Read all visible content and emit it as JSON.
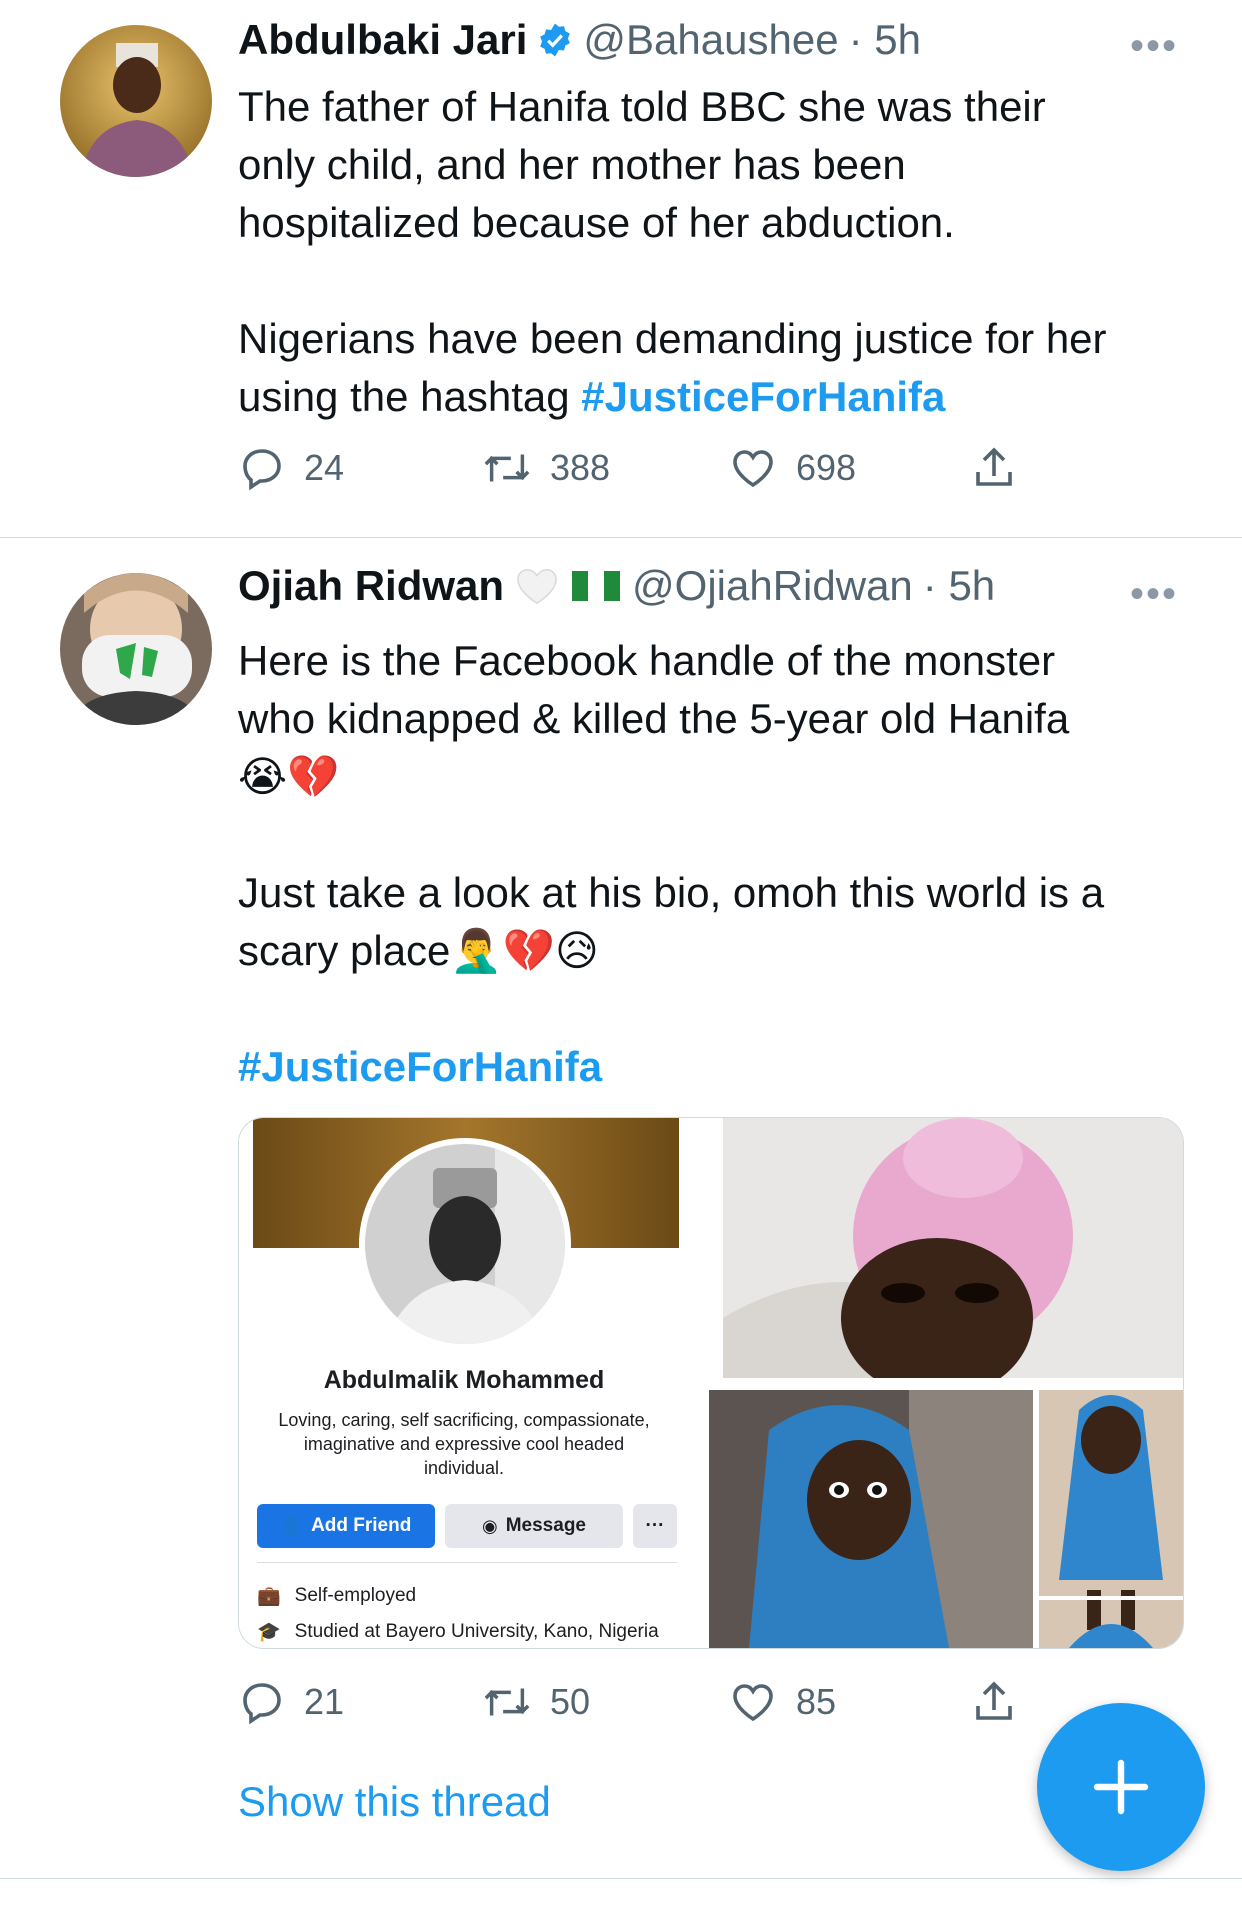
{
  "tweet1": {
    "name": "Abdulbaki Jari",
    "handle": "@Bahaushee",
    "time": "· 5h",
    "line1": "The father of Hanifa told BBC she was their",
    "line2": "only child, and her mother has been",
    "line3": "hospitalized because of her abduction.",
    "line4": "Nigerians have been demanding justice for her",
    "line5_prefix": "using the hashtag ",
    "hashtag": "#JusticeForHanifa",
    "replies": "24",
    "retweets": "388",
    "likes": "698"
  },
  "tweet2": {
    "name": "Ojiah Ridwan",
    "handle": "@OjiahRidwan",
    "time": "· 5h",
    "line1": "Here is the Facebook handle of the monster",
    "line2": "who kidnapped & killed the 5-year old Hanifa",
    "line3": "😭💔",
    "line4": "Just take a look at his bio, omoh this world is a",
    "line5": "scary place🤦‍♂️💔😥",
    "hashtag": "#JusticeForHanifa",
    "replies": "21",
    "retweets": "50",
    "likes": "85"
  },
  "facebook_card": {
    "profile_name": "Abdulmalik Mohammed",
    "bio_line1": "Loving, caring, self sacrificing, compassionate,",
    "bio_line2": "imaginative and expressive cool headed",
    "bio_line3": "individual.",
    "add_friend": "Add Friend",
    "message": "Message",
    "more": "···",
    "work": "Self-employed",
    "education": "Studied at Bayero University, Kano, Nigeria"
  },
  "show_thread": "Show this thread",
  "more_menu": "•••",
  "colors": {
    "accent": "#1d9bf0",
    "text": "#0f1419",
    "muted": "#536471",
    "fb_blue": "#1b74e4"
  }
}
